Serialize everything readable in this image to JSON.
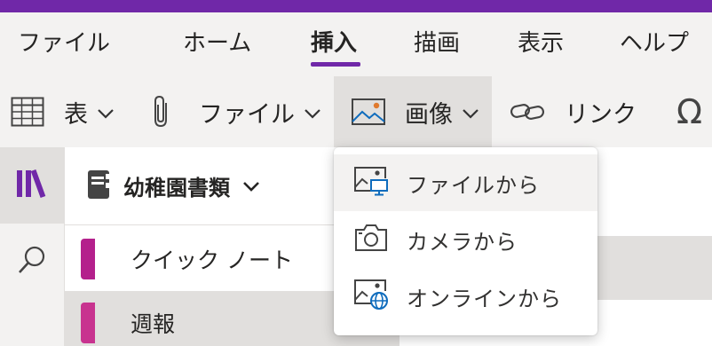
{
  "colors": {
    "accent": "#7028a8",
    "section_quick_note": "#b4208c",
    "section_weekly": "#c8338f",
    "icon_blue": "#0f6cbd",
    "icon_orange": "#e07a2e"
  },
  "tabs": [
    {
      "label": "ファイル",
      "active": false
    },
    {
      "label": "ホーム",
      "active": false
    },
    {
      "label": "挿入",
      "active": true
    },
    {
      "label": "描画",
      "active": false
    },
    {
      "label": "表示",
      "active": false
    },
    {
      "label": "ヘルプ",
      "active": false
    }
  ],
  "ribbon": {
    "table": {
      "label": "表",
      "icon": "table-icon"
    },
    "file": {
      "label": "ファイル",
      "icon": "paperclip-icon"
    },
    "image": {
      "label": "画像",
      "icon": "image-icon"
    },
    "link": {
      "label": "リンク",
      "icon": "link-icon"
    },
    "symbol": {
      "icon": "omega-icon"
    }
  },
  "rail": {
    "items": [
      {
        "icon": "notebooks-icon"
      },
      {
        "icon": "search-icon"
      }
    ]
  },
  "notebook": {
    "name": "幼稚園書類",
    "sections": [
      {
        "label": "クイック ノート"
      },
      {
        "label": "週報"
      }
    ]
  },
  "image_menu": {
    "items": [
      {
        "label": "ファイルから",
        "icon": "image-from-file-icon"
      },
      {
        "label": "カメラから",
        "icon": "camera-icon"
      },
      {
        "label": "オンラインから",
        "icon": "image-online-icon"
      }
    ]
  }
}
